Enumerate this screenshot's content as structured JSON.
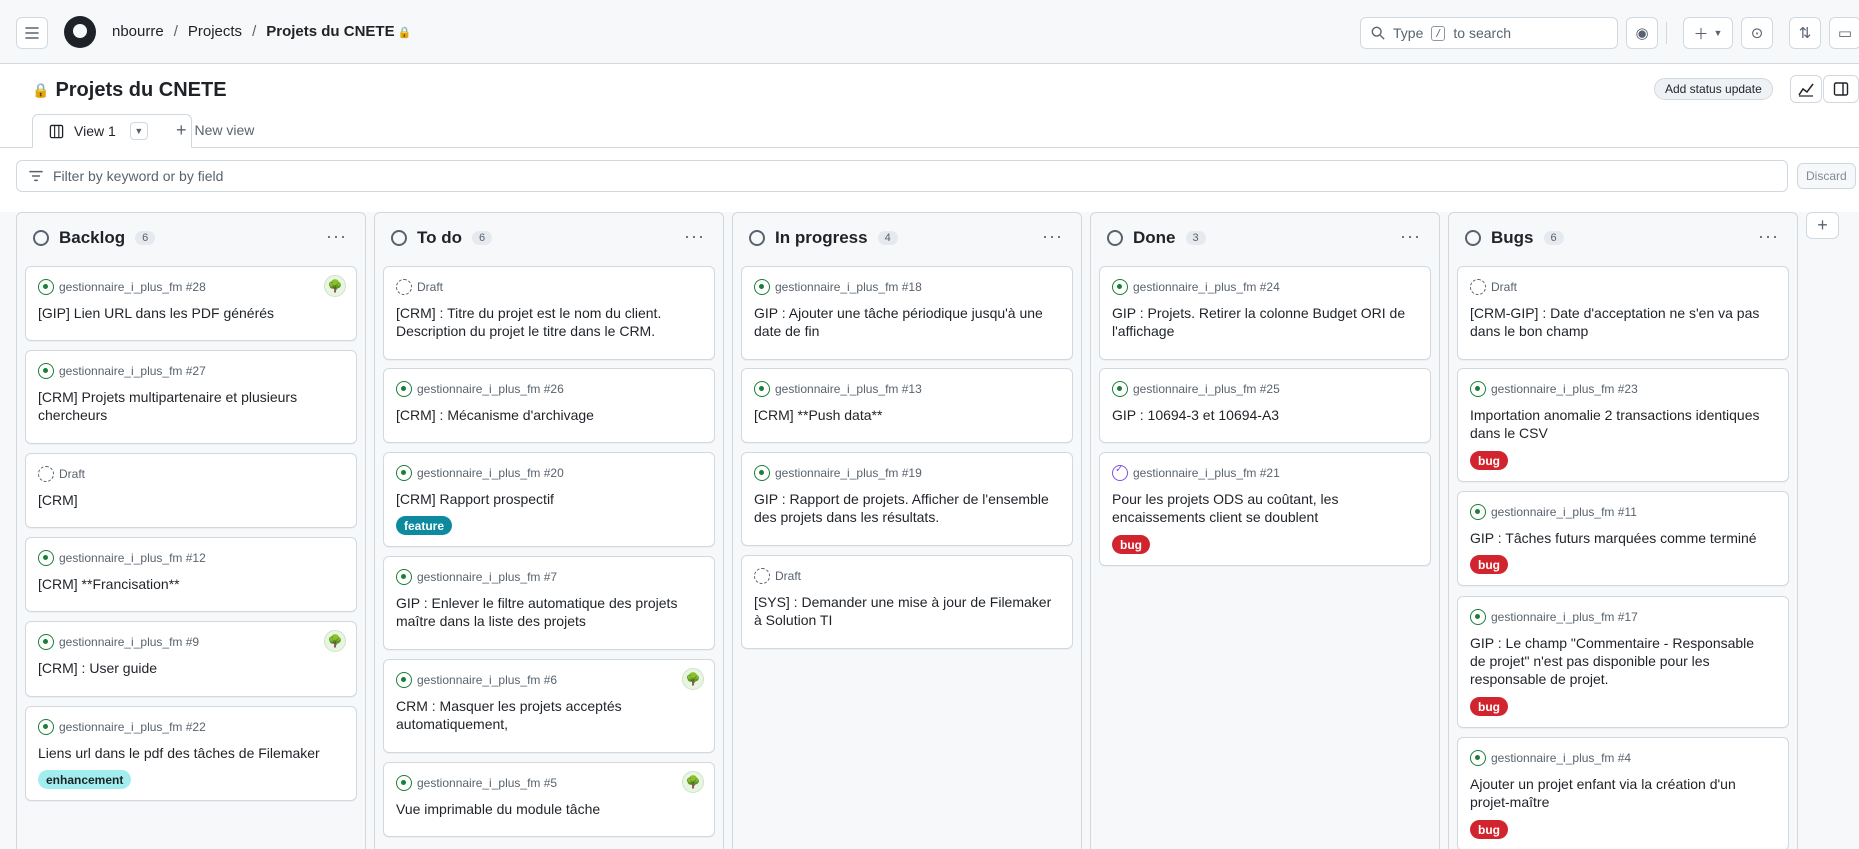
{
  "header": {
    "owner": "nbourre",
    "projects": "Projects",
    "current": "Projets du CNETE",
    "search_prefix": "Type",
    "search_key": "/",
    "search_suffix": "to search"
  },
  "project": {
    "title": "Projets du CNETE",
    "status_button": "Add status update"
  },
  "views": {
    "active_tab": "View 1",
    "new_view": "New view"
  },
  "filter": {
    "placeholder": "Filter by keyword or by field",
    "discard": "Discard"
  },
  "columns": [
    {
      "name": "Backlog",
      "count": "6",
      "cards": [
        {
          "meta": "gestionnaire_i_plus_fm #28",
          "title": "[GIP] Lien URL dans les PDF générés"
        },
        {
          "meta": "gestionnaire_i_plus_fm #27",
          "title": "[CRM] Projets multipartenaire et plusieurs chercheurs"
        },
        {
          "meta": "Draft",
          "title": "[CRM]"
        },
        {
          "meta": "gestionnaire_i_plus_fm #12",
          "title": "[CRM] **Francisation**"
        },
        {
          "meta": "gestionnaire_i_plus_fm #9",
          "title": "[CRM] : User guide"
        },
        {
          "meta": "gestionnaire_i_plus_fm #22",
          "title": "Liens url dans le pdf des tâches de Filemaker",
          "label": "enhancement"
        }
      ]
    },
    {
      "name": "To do",
      "count": "6",
      "cards": [
        {
          "meta": "Draft",
          "title": "[CRM] : Titre du projet est le nom du client. Description du projet le titre dans le CRM."
        },
        {
          "meta": "gestionnaire_i_plus_fm #26",
          "title": "[CRM] : Mécanisme d'archivage"
        },
        {
          "meta": "gestionnaire_i_plus_fm #20",
          "title": "[CRM] Rapport prospectif",
          "label": "feature"
        },
        {
          "meta": "gestionnaire_i_plus_fm #7",
          "title": "GIP : Enlever le filtre automatique des projets maître dans la liste des projets"
        },
        {
          "meta": "gestionnaire_i_plus_fm #6",
          "title": "CRM : Masquer les projets acceptés automatiquement,"
        },
        {
          "meta": "gestionnaire_i_plus_fm #5",
          "title": "Vue imprimable du module tâche"
        }
      ]
    },
    {
      "name": "In progress",
      "count": "4",
      "cards": [
        {
          "meta": "gestionnaire_i_plus_fm #18",
          "title": "GIP : Ajouter une tâche périodique jusqu'à une date de fin"
        },
        {
          "meta": "gestionnaire_i_plus_fm #13",
          "title": "[CRM] **Push data**"
        },
        {
          "meta": "gestionnaire_i_plus_fm #19",
          "title": "GIP : Rapport de projets. Afficher de l'ensemble des projets dans les résultats."
        },
        {
          "meta": "Draft",
          "title": "[SYS] : Demander une mise à jour de Filemaker à Solution TI"
        }
      ]
    },
    {
      "name": "Done",
      "count": "3",
      "cards": [
        {
          "meta": "gestionnaire_i_plus_fm #24",
          "title": "GIP : Projets. Retirer la colonne Budget ORI de l'affichage"
        },
        {
          "meta": "gestionnaire_i_plus_fm #25",
          "title": "GIP : 10694-3 et 10694-A3"
        },
        {
          "meta": "gestionnaire_i_plus_fm #21",
          "title": "Pour les projets ODS au coûtant, les encaissements client se doublent",
          "label": "bug"
        }
      ]
    },
    {
      "name": "Bugs",
      "count": "6",
      "cards": [
        {
          "meta": "Draft",
          "title": "[CRM-GIP] : Date d'acceptation ne s'en va pas dans le bon champ"
        },
        {
          "meta": "gestionnaire_i_plus_fm #23",
          "title": "Importation anomalie 2 transactions identiques dans le CSV",
          "label": "bug"
        },
        {
          "meta": "gestionnaire_i_plus_fm #11",
          "title": "GIP : Tâches futurs marquées comme terminé",
          "label": "bug"
        },
        {
          "meta": "gestionnaire_i_plus_fm #17",
          "title": "GIP : Le champ \"Commentaire - Responsable de projet\" n'est pas disponible pour les responsable de projet.",
          "label": "bug"
        },
        {
          "meta": "gestionnaire_i_plus_fm #4",
          "title": "Ajouter un projet enfant via la création d'un projet-maître",
          "label": "bug"
        }
      ]
    }
  ],
  "colors": {
    "bug": "#d1242f",
    "feature": "#0e8a9f",
    "enhancement": "#a2eeef",
    "open_issue": "#1a7f37",
    "closed_issue": "#8250df"
  }
}
